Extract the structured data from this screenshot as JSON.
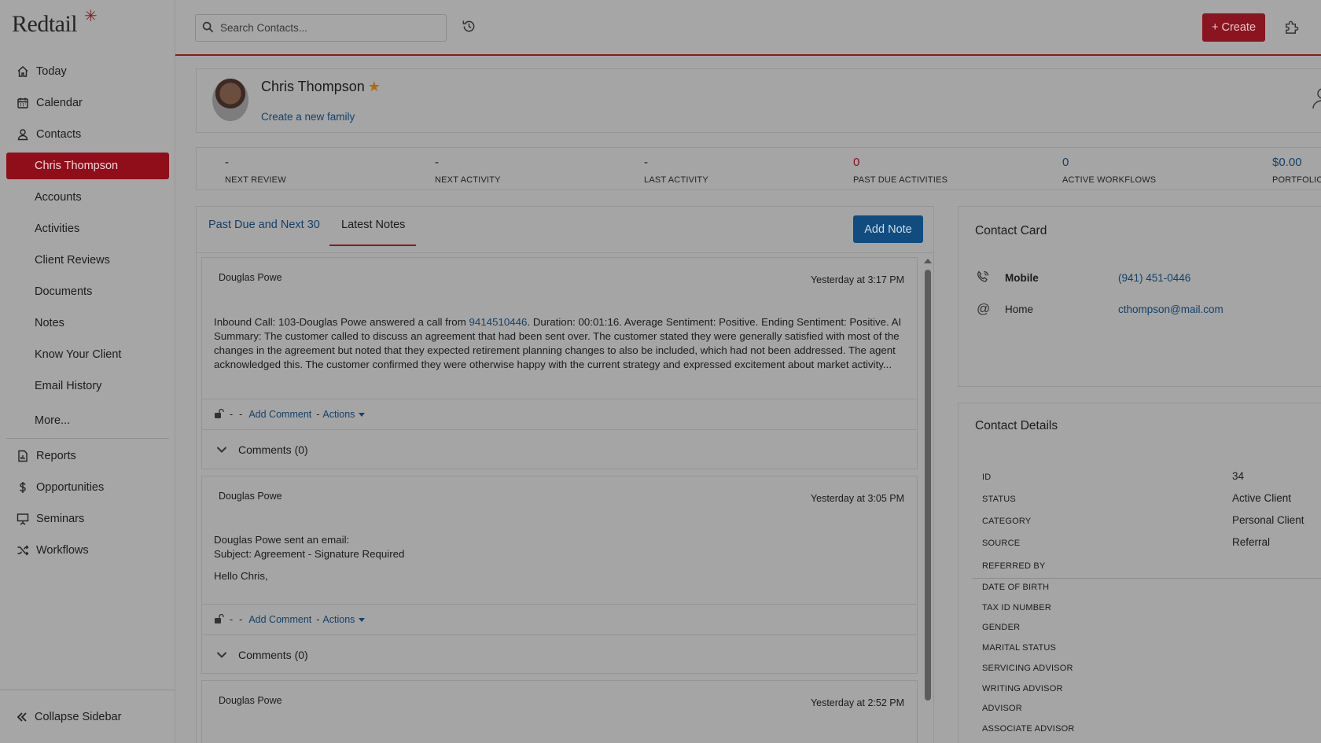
{
  "app": {
    "logo": "Redtail"
  },
  "sidebar": {
    "items": [
      {
        "label": "Today",
        "icon": "home-icon"
      },
      {
        "label": "Calendar",
        "icon": "calendar-icon"
      },
      {
        "label": "Contacts",
        "icon": "person-icon"
      },
      {
        "label": "Chris Thompson",
        "active": true
      },
      {
        "label": "Accounts"
      },
      {
        "label": "Activities"
      },
      {
        "label": "Client Reviews"
      },
      {
        "label": "Documents"
      },
      {
        "label": "Notes"
      },
      {
        "label": "Know Your Client"
      },
      {
        "label": "Email History"
      },
      {
        "label": "More..."
      },
      {
        "label": "Reports",
        "icon": "report-icon"
      },
      {
        "label": "Opportunities",
        "icon": "dollar-icon"
      },
      {
        "label": "Seminars",
        "icon": "presentation-icon"
      },
      {
        "label": "Workflows",
        "icon": "shuffle-icon"
      }
    ],
    "collapse_label": "Collapse Sidebar"
  },
  "topbar": {
    "search_placeholder": "Search Contacts...",
    "create_label": "+ Create"
  },
  "profile": {
    "name": "Chris Thompson",
    "family_link": "Create a new family"
  },
  "stats": [
    {
      "value": "-",
      "label": "NEXT REVIEW"
    },
    {
      "value": "-",
      "label": "NEXT ACTIVITY"
    },
    {
      "value": "-",
      "label": "LAST ACTIVITY"
    },
    {
      "value": "0",
      "label": "PAST DUE ACTIVITIES"
    },
    {
      "value": "0",
      "label": "ACTIVE WORKFLOWS"
    },
    {
      "value": "$0.00",
      "label": "PORTFOLIO"
    }
  ],
  "notes": {
    "tabs": [
      "Past Due and Next 30",
      "Latest Notes"
    ],
    "add_note_label": "Add Note",
    "items": [
      {
        "author": "Douglas Powe",
        "time": "Yesterday at 3:17 PM",
        "body_pre": "Inbound Call: 103-Douglas Powe answered a call from ",
        "body_link": "9414510446",
        "body_post": ". Duration: 00:01:16. Average Sentiment: Positive. Ending Sentiment: Positive. AI Summary: The customer called to discuss an agreement that had been sent over. The customer stated they were generally satisfied with most of the changes in the agreement but noted that they expected retirement planning changes to also be included, which had not been addressed. The agent acknowledged this. The customer confirmed they were otherwise happy with the current strategy and expressed excitement about market activity...",
        "add_comment": "Add Comment",
        "actions": "Actions",
        "comments": "Comments (0)"
      },
      {
        "author": "Douglas Powe",
        "time": "Yesterday at 3:05 PM",
        "line1": "Douglas Powe sent an email:",
        "line2": "Subject: Agreement - Signature Required",
        "line3": "Hello Chris,",
        "add_comment": "Add Comment",
        "actions": "Actions",
        "comments": "Comments (0)"
      },
      {
        "author": "Douglas Powe",
        "time": "Yesterday at 2:52 PM"
      }
    ]
  },
  "contact_card": {
    "title": "Contact Card",
    "phone": {
      "label": "Mobile",
      "value": "(941) 451-0446"
    },
    "email": {
      "label": "Home",
      "value": "cthompson@mail.com"
    }
  },
  "contact_details": {
    "title": "Contact Details",
    "rows": [
      {
        "label": "ID",
        "value": "34"
      },
      {
        "label": "STATUS",
        "value": "Active Client"
      },
      {
        "label": "CATEGORY",
        "value": "Personal Client"
      },
      {
        "label": "SOURCE",
        "value": "Referral"
      },
      {
        "label": "REFERRED BY",
        "value": ""
      },
      {
        "label": "DATE OF BIRTH",
        "value": ""
      },
      {
        "label": "TAX ID NUMBER",
        "value": ""
      },
      {
        "label": "GENDER",
        "value": ""
      },
      {
        "label": "MARITAL STATUS",
        "value": ""
      },
      {
        "label": "SERVICING ADVISOR",
        "value": ""
      },
      {
        "label": "WRITING ADVISOR",
        "value": ""
      },
      {
        "label": "ADVISOR",
        "value": ""
      },
      {
        "label": "ASSOCIATE ADVISOR",
        "value": ""
      }
    ]
  },
  "colors": {
    "brand_red": "#8b1a1a",
    "link_blue": "#14416b",
    "button_blue": "#114c80",
    "overlay_gray": "#a5a5a5"
  }
}
